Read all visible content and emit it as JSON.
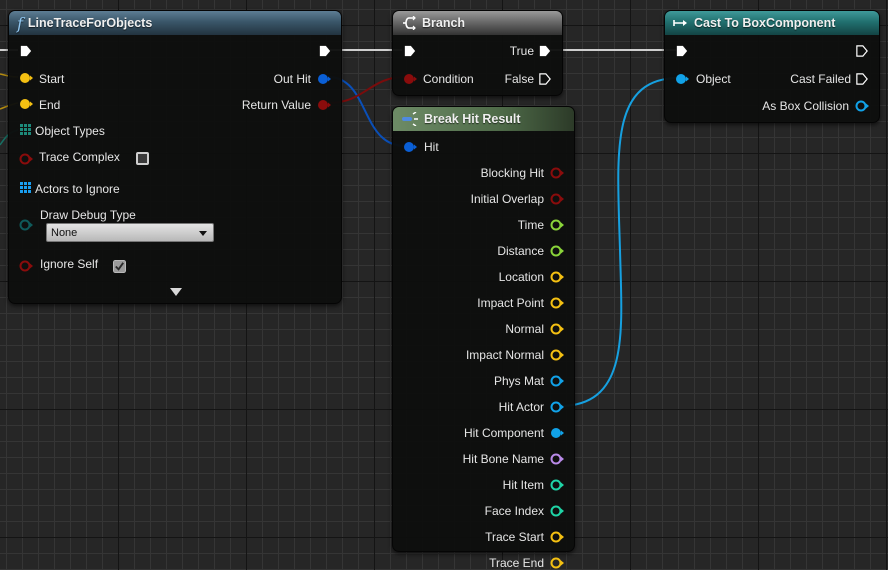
{
  "colors": {
    "exec": "#ffffff",
    "vector": "#f4c012",
    "struct_hit": "#0a5fd6",
    "bool": "#8a0c0c",
    "object_types": "#1d8a7a",
    "actor_array": "#1a9ef0",
    "enum": "#0f5a5a",
    "float": "#8ad43a",
    "object": "#11a2e8",
    "name": "#b98ae8",
    "int": "#1fd4a6",
    "wire_exec": "#d9d9d9",
    "wire_hit": "#0a4fb8",
    "wire_bool": "#7a0c0c",
    "wire_object": "#16a0e0"
  },
  "nodes": {
    "line_trace": {
      "title": "LineTraceForObjects",
      "icon": "function-icon",
      "inputs": {
        "start": "Start",
        "end": "End",
        "object_types": "Object Types",
        "trace_complex": "Trace Complex",
        "actors_to_ignore": "Actors to Ignore",
        "draw_debug_type": "Draw Debug Type",
        "ignore_self": "Ignore Self"
      },
      "draw_debug_value": "None",
      "trace_complex_checked": false,
      "ignore_self_checked": true,
      "outputs": {
        "out_hit": "Out Hit",
        "return_value": "Return Value"
      },
      "expand_icon": "advanced-display-arrow-icon"
    },
    "branch": {
      "title": "Branch",
      "icon": "branch-icon",
      "inputs": {
        "condition": "Condition"
      },
      "outputs": {
        "true": "True",
        "false": "False"
      }
    },
    "break_hit": {
      "title": "Break Hit Result",
      "icon": "break-struct-icon",
      "inputs": {
        "hit": "Hit"
      },
      "outputs": [
        {
          "label": "Blocking Hit",
          "type": "bool",
          "connected": false
        },
        {
          "label": "Initial Overlap",
          "type": "bool",
          "connected": false
        },
        {
          "label": "Time",
          "type": "float",
          "connected": false
        },
        {
          "label": "Distance",
          "type": "float",
          "connected": false
        },
        {
          "label": "Location",
          "type": "vector",
          "connected": false
        },
        {
          "label": "Impact Point",
          "type": "vector",
          "connected": false
        },
        {
          "label": "Normal",
          "type": "vector",
          "connected": false
        },
        {
          "label": "Impact Normal",
          "type": "vector",
          "connected": false
        },
        {
          "label": "Phys Mat",
          "type": "object",
          "connected": false
        },
        {
          "label": "Hit Actor",
          "type": "object",
          "connected": false
        },
        {
          "label": "Hit Component",
          "type": "object",
          "connected": true
        },
        {
          "label": "Hit Bone Name",
          "type": "name",
          "connected": false
        },
        {
          "label": "Hit Item",
          "type": "int",
          "connected": false
        },
        {
          "label": "Face Index",
          "type": "int",
          "connected": false
        },
        {
          "label": "Trace Start",
          "type": "vector",
          "connected": false
        },
        {
          "label": "Trace End",
          "type": "vector",
          "connected": false
        }
      ]
    },
    "cast": {
      "title": "Cast To BoxComponent",
      "icon": "cast-icon",
      "inputs": {
        "object": "Object"
      },
      "outputs": {
        "cast_failed": "Cast Failed",
        "as_box_collision": "As Box Collision"
      }
    }
  }
}
